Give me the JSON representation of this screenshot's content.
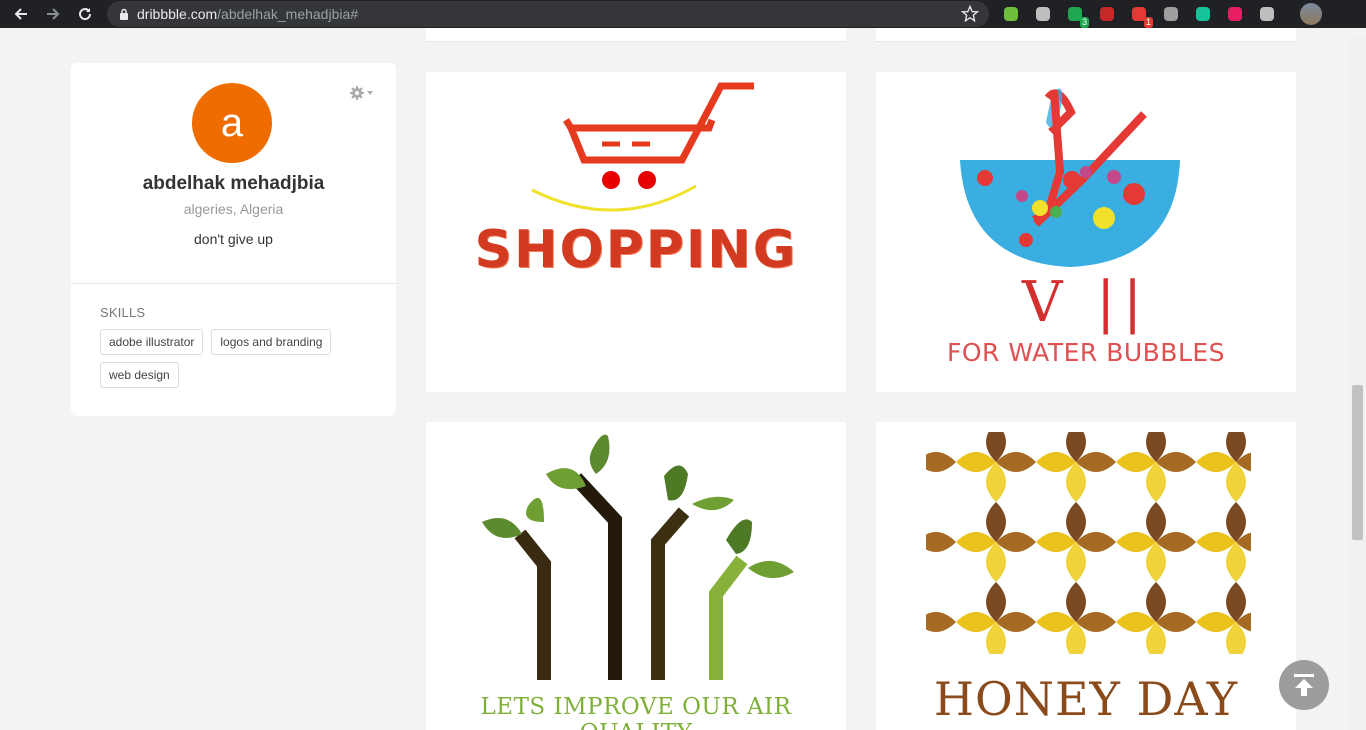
{
  "browser": {
    "url_domain": "dribbble.com",
    "url_path": "/abdelhak_mehadjbia#",
    "extensions": [
      {
        "name": "evernote-ext",
        "color": "#6fbf3f",
        "badge": ""
      },
      {
        "name": "bing-ext",
        "color": "#bdbdbd",
        "badge": ""
      },
      {
        "name": "todo-check-ext",
        "color": "#1fa84f",
        "badge": "3"
      },
      {
        "name": "pdf-ext",
        "color": "#c62828",
        "badge": ""
      },
      {
        "name": "notification-ext",
        "color": "#e53935",
        "badge": "1"
      },
      {
        "name": "m-ext",
        "color": "#9e9e9e",
        "badge": ""
      },
      {
        "name": "grammarly-ext",
        "color": "#15c39a",
        "badge": ""
      },
      {
        "name": "colorpick-ext",
        "color": "#e91e63",
        "badge": ""
      },
      {
        "name": "vimium-ext",
        "color": "#bdbdbd",
        "badge": ""
      }
    ]
  },
  "profile": {
    "avatar_letter": "a",
    "avatar_color": "#ef6c00",
    "name": "abdelhak mehadjbia",
    "location": "algeries, Algeria",
    "bio": "don't give up",
    "skills_title": "SKILLS",
    "skills": [
      "adobe illustrator",
      "logos and branding",
      "web design"
    ]
  },
  "shots": {
    "shopping_text": "SHOPPING",
    "water_title": "V ||",
    "water_subtitle": "FOR WATER BUBBLES",
    "air_text": "LETS IMPROVE OUR AIR QUALITY",
    "honey_text": "HONEY DAY"
  }
}
